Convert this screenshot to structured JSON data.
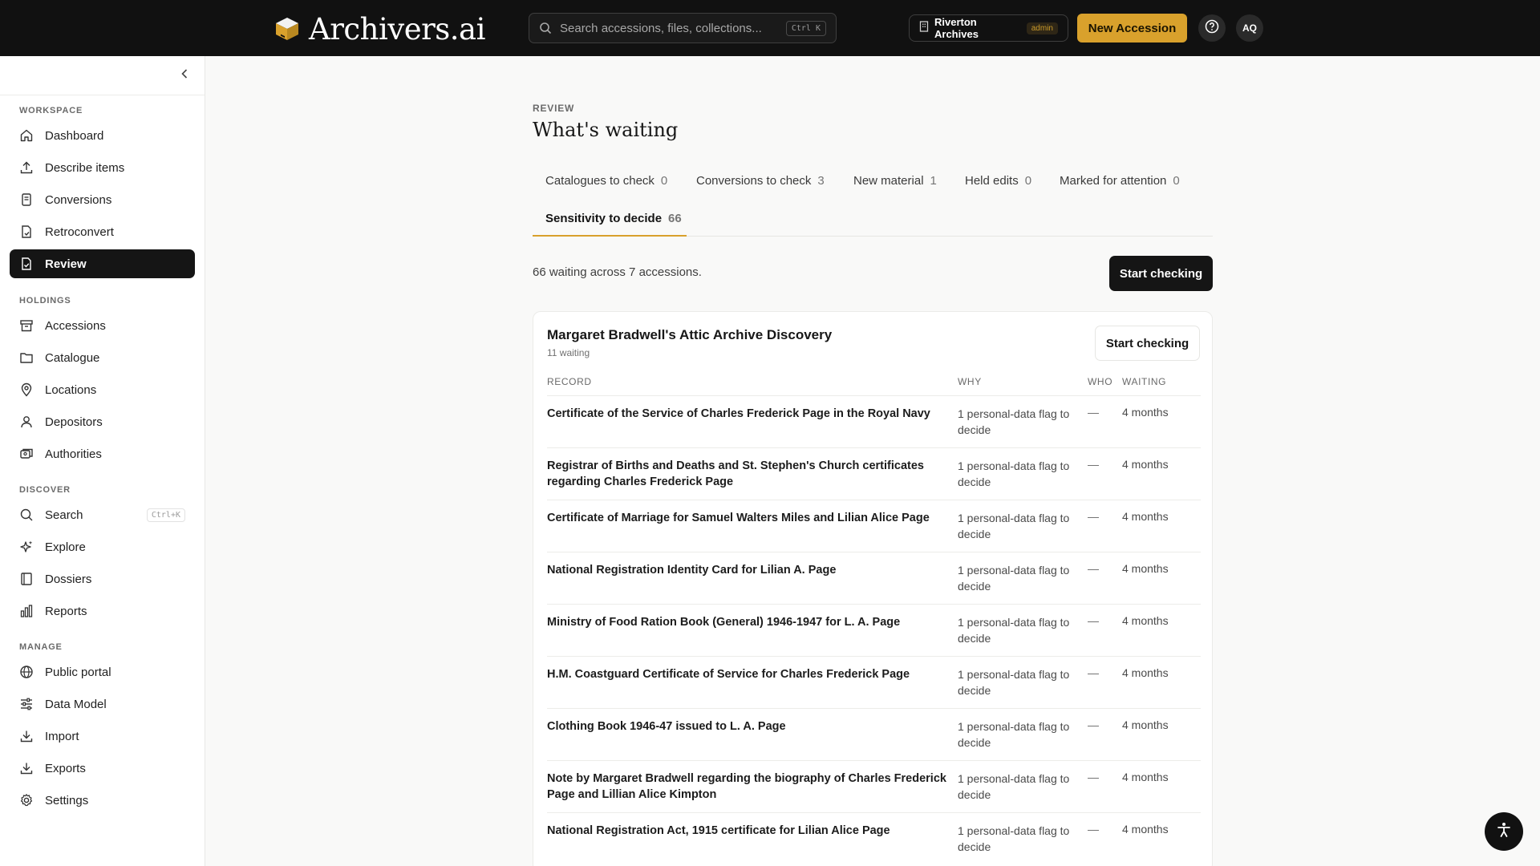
{
  "header": {
    "brand": "Archivers.ai",
    "search_placeholder": "Search accessions, files, collections...",
    "search_shortcut": "Ctrl K",
    "org_name": "Riverton Archives",
    "org_role": "admin",
    "new_accession_label": "New Accession",
    "avatar_initials": "AQ"
  },
  "sidebar": {
    "sections": [
      {
        "label": "WORKSPACE",
        "items": [
          {
            "label": "Dashboard",
            "icon": "home-icon"
          },
          {
            "label": "Describe items",
            "icon": "upload-icon"
          },
          {
            "label": "Conversions",
            "icon": "convert-icon"
          },
          {
            "label": "Retroconvert",
            "icon": "retroconvert-icon"
          },
          {
            "label": "Review",
            "icon": "review-icon",
            "active": true
          }
        ]
      },
      {
        "label": "HOLDINGS",
        "items": [
          {
            "label": "Accessions",
            "icon": "archive-box-icon"
          },
          {
            "label": "Catalogue",
            "icon": "folder-icon"
          },
          {
            "label": "Locations",
            "icon": "map-pin-icon"
          },
          {
            "label": "Depositors",
            "icon": "person-icon"
          },
          {
            "label": "Authorities",
            "icon": "authorities-icon"
          }
        ]
      },
      {
        "label": "DISCOVER",
        "items": [
          {
            "label": "Search",
            "icon": "search-icon",
            "shortcut": "Ctrl+K"
          },
          {
            "label": "Explore",
            "icon": "sparkle-icon"
          },
          {
            "label": "Dossiers",
            "icon": "book-icon"
          },
          {
            "label": "Reports",
            "icon": "bar-chart-icon"
          }
        ]
      },
      {
        "label": "MANAGE",
        "items": [
          {
            "label": "Public portal",
            "icon": "globe-icon"
          },
          {
            "label": "Data Model",
            "icon": "sliders-icon"
          },
          {
            "label": "Import",
            "icon": "import-icon"
          },
          {
            "label": "Exports",
            "icon": "export-icon"
          },
          {
            "label": "Settings",
            "icon": "gear-icon"
          }
        ]
      }
    ]
  },
  "main": {
    "eyebrow": "REVIEW",
    "title": "What's waiting",
    "tabs": [
      {
        "label": "Catalogues to check",
        "count": "0"
      },
      {
        "label": "Conversions to check",
        "count": "3"
      },
      {
        "label": "New material",
        "count": "1"
      },
      {
        "label": "Held edits",
        "count": "0"
      },
      {
        "label": "Marked for attention",
        "count": "0"
      },
      {
        "label": "Sensitivity to decide",
        "count": "66",
        "active": true
      }
    ],
    "summary": "66 waiting across 7 accessions.",
    "start_checking_label": "Start checking",
    "accent_color": "#d9a12c"
  },
  "card": {
    "title": "Margaret Bradwell's Attic Archive Discovery",
    "subtitle": "11 waiting",
    "start_checking_label": "Start checking",
    "columns": [
      "RECORD",
      "WHY",
      "WHO",
      "WAITING"
    ],
    "rows": [
      {
        "record": "Certificate of the Service of Charles Frederick Page in the Royal Navy",
        "why": "1 personal-data flag to decide",
        "who": "—",
        "waiting": "4 months"
      },
      {
        "record": "Registrar of Births and Deaths and St. Stephen's Church certificates regarding Charles Frederick Page",
        "why": "1 personal-data flag to decide",
        "who": "—",
        "waiting": "4 months"
      },
      {
        "record": "Certificate of Marriage for Samuel Walters Miles and Lilian Alice Page",
        "why": "1 personal-data flag to decide",
        "who": "—",
        "waiting": "4 months"
      },
      {
        "record": "National Registration Identity Card for Lilian A. Page",
        "why": "1 personal-data flag to decide",
        "who": "—",
        "waiting": "4 months"
      },
      {
        "record": "Ministry of Food Ration Book (General) 1946-1947 for L. A. Page",
        "why": "1 personal-data flag to decide",
        "who": "—",
        "waiting": "4 months"
      },
      {
        "record": "H.M. Coastguard Certificate of Service for Charles Frederick Page",
        "why": "1 personal-data flag to decide",
        "who": "—",
        "waiting": "4 months"
      },
      {
        "record": "Clothing Book 1946-47 issued to L. A. Page",
        "why": "1 personal-data flag to decide",
        "who": "—",
        "waiting": "4 months"
      },
      {
        "record": "Note by Margaret Bradwell regarding the biography of Charles Frederick Page and Lillian Alice Kimpton",
        "why": "1 personal-data flag to decide",
        "who": "—",
        "waiting": "4 months"
      },
      {
        "record": "National Registration Act, 1915 certificate for Lilian Alice Page",
        "why": "1 personal-data flag to decide",
        "who": "—",
        "waiting": "4 months"
      }
    ]
  }
}
